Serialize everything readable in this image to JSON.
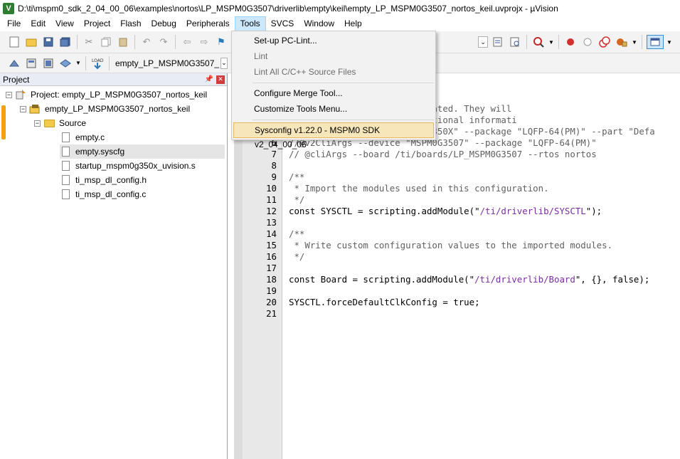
{
  "window": {
    "title": "D:\\ti\\mspm0_sdk_2_04_00_06\\examples\\nortos\\LP_MSPM0G3507\\driverlib\\empty\\keil\\empty_LP_MSPM0G3507_nortos_keil.uvprojx - µVision",
    "app_icon": "V"
  },
  "menubar": {
    "items": [
      "File",
      "Edit",
      "View",
      "Project",
      "Flash",
      "Debug",
      "Peripherals",
      "Tools",
      "SVCS",
      "Window",
      "Help"
    ],
    "active": "Tools"
  },
  "tools_menu": {
    "items": [
      {
        "label": "Set-up PC-Lint...",
        "disabled": false
      },
      {
        "label": "Lint",
        "disabled": true
      },
      {
        "label": "Lint All C/C++ Source Files",
        "disabled": true
      },
      {
        "label": "Configure Merge Tool...",
        "disabled": false
      },
      {
        "label": "Customize Tools Menu...",
        "disabled": false
      },
      {
        "label": "Sysconfig v1.22.0 - MSPM0 SDK v2_04_00_06",
        "disabled": false,
        "highlighted": true
      }
    ]
  },
  "toolbar2": {
    "target_select": "empty_LP_MSPM0G3507_"
  },
  "project_panel": {
    "title": "Project",
    "tree": [
      {
        "label": "Project: empty_LP_MSPM0G3507_nortos_keil",
        "level": 0
      },
      {
        "label": "empty_LP_MSPM0G3507_nortos_keil",
        "level": 1
      },
      {
        "label": "Source",
        "level": 2
      },
      {
        "label": "empty.c",
        "level": 3
      },
      {
        "label": "empty.syscfg",
        "level": 3,
        "selected": true
      },
      {
        "label": "startup_mspm0g350x_uvision.s",
        "level": 3
      },
      {
        "label": "ti_msp_dl_config.h",
        "level": 3
      },
      {
        "label": "ti_msp_dl_config.c",
        "level": 3
      }
    ]
  },
  "editor": {
    "lines": [
      {
        "n": "",
        "text": "ed when this file was generated. They will"
      },
      {
        "n": "",
        "text": " CLI with '--help' for additional informati"
      },
      {
        "n": "5",
        "text": "//@cliArgs --device \"MSPM0G350X\" --package \"LQFP-64(PM)\" --part \"Defa"
      },
      {
        "n": "6",
        "text": "//@v2CliArgs --device \"MSPM0G3507\" --package \"LQFP-64(PM)\""
      },
      {
        "n": "7",
        "text": "// @cliArgs --board /ti/boards/LP_MSPM0G3507 --rtos nortos"
      },
      {
        "n": "8",
        "text": ""
      },
      {
        "n": "9",
        "text": "/**"
      },
      {
        "n": "10",
        "text": " * Import the modules used in this configuration."
      },
      {
        "n": "11",
        "text": " */"
      },
      {
        "n": "12",
        "text": "const SYSCTL = scripting.addModule(\"/ti/driverlib/SYSCTL\");"
      },
      {
        "n": "13",
        "text": ""
      },
      {
        "n": "14",
        "text": "/**"
      },
      {
        "n": "15",
        "text": " * Write custom configuration values to the imported modules."
      },
      {
        "n": "16",
        "text": " */"
      },
      {
        "n": "17",
        "text": ""
      },
      {
        "n": "18",
        "text": "const Board = scripting.addModule(\"/ti/driverlib/Board\", {}, false);"
      },
      {
        "n": "19",
        "text": ""
      },
      {
        "n": "20",
        "text": "SYSCTL.forceDefaultClkConfig = true;"
      },
      {
        "n": "21",
        "text": ""
      }
    ]
  },
  "colors": {
    "menu_active_bg": "#cce8ff",
    "menu_highlight_bg": "#f7e6b9",
    "selection_bg": "#e5e5e5",
    "string_color": "#7d2ba2",
    "comment_color": "#606060"
  }
}
